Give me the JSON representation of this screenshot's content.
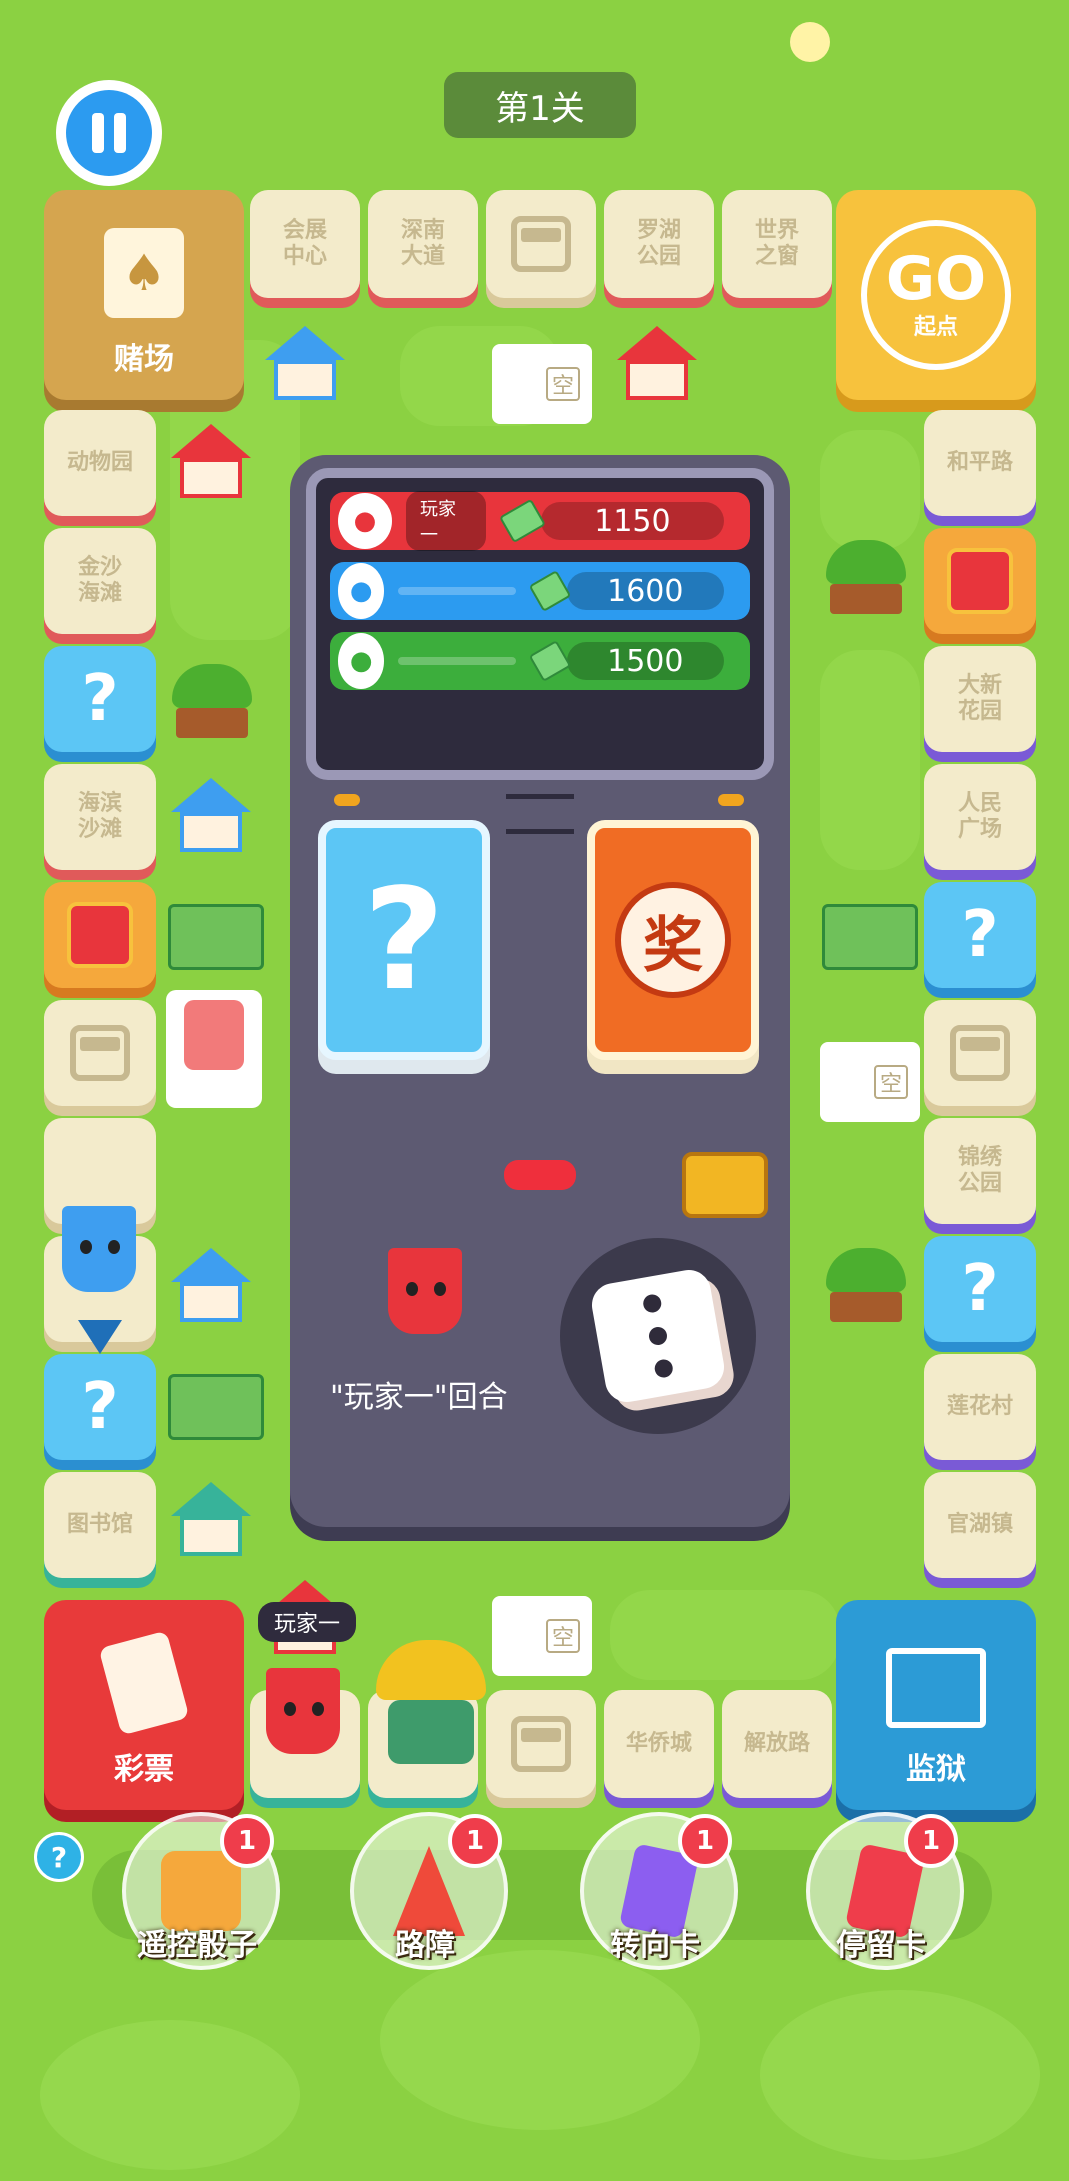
{
  "level": "第1关",
  "top_tiles": [
    "会展\n中心",
    "深南\n大道",
    "",
    "罗湖\n公园",
    "世界\n之窗"
  ],
  "left_tiles": [
    "动物园",
    "金沙\n海滩",
    "?",
    "海滨\n沙滩",
    "",
    "",
    "",
    "",
    "?",
    "图书馆"
  ],
  "right_tiles": [
    "和平路",
    "",
    "大新\n花园",
    "人民\n广场",
    "?",
    "",
    "锦绣\n公园",
    "?",
    "莲花村",
    "官湖镇"
  ],
  "bottom_tiles": [
    "",
    "",
    "",
    "华侨城",
    "解放路"
  ],
  "corners": {
    "casino": "赌场",
    "start_go": "GO",
    "start": "起点",
    "lottery": "彩票",
    "jail": "监狱"
  },
  "bus_stop_label": "空",
  "players": [
    {
      "name": "玩家一",
      "money": "1150",
      "color": "#e8353c"
    },
    {
      "name": "",
      "money": "1600",
      "color": "#2c9bf0"
    },
    {
      "name": "",
      "money": "1500",
      "color": "#3cae3c"
    }
  ],
  "center": {
    "question_card": "?",
    "reward_card": "奖",
    "turn_text": "\"玩家一\"回合"
  },
  "player_tag": "玩家一",
  "props": [
    {
      "label": "遥控骰子",
      "count": "1",
      "icon": "dice-icon"
    },
    {
      "label": "路障",
      "count": "1",
      "icon": "cone-icon"
    },
    {
      "label": "转向卡",
      "count": "1",
      "icon": "turn-card-icon"
    },
    {
      "label": "停留卡",
      "count": "1",
      "icon": "stop-card-icon"
    }
  ],
  "help": "?",
  "colors": {
    "background": "#8bd142",
    "tile": "#f3ebcb",
    "red": "#e8353c",
    "blue": "#2c9bf0",
    "green": "#3cae3c",
    "panel": "#5d5a72"
  }
}
